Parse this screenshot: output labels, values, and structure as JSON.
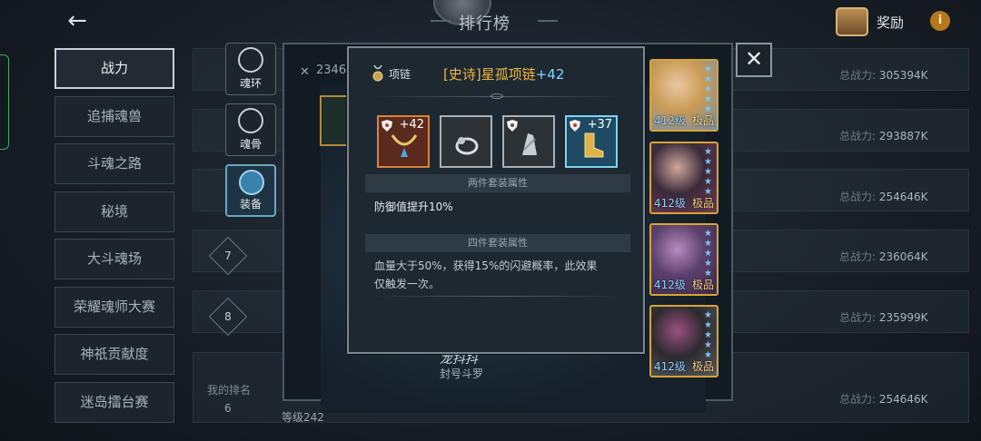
{
  "header": {
    "title": "排行榜",
    "reward_label": "奖励",
    "info_label": "i"
  },
  "categories": [
    {
      "label": "战力",
      "active": true
    },
    {
      "label": "追捕魂兽"
    },
    {
      "label": "斗魂之路"
    },
    {
      "label": "秘境"
    },
    {
      "label": "大斗魂场"
    },
    {
      "label": "荣耀魂师大赛"
    },
    {
      "label": "神祇贡献度"
    },
    {
      "label": "迷岛擂台赛"
    }
  ],
  "rankings": {
    "power_label": "总战力:",
    "rows": [
      {
        "rank": "",
        "power": "305394K"
      },
      {
        "rank": "",
        "power": "293887K"
      },
      {
        "rank": "",
        "power": "254646K"
      },
      {
        "rank": "7",
        "power": "236064K"
      },
      {
        "rank": "8",
        "power": "235999K"
      }
    ],
    "my_rank_label": "我的排名",
    "my_rank_value": "6",
    "my_power": "254646K"
  },
  "player": {
    "id_prefix": "2346",
    "name": "龙抖抖",
    "title": "封号斗罗",
    "level_text": "等级242"
  },
  "side_tabs": [
    {
      "label": "魂环",
      "icon": "soul-ring-icon"
    },
    {
      "label": "魂骨",
      "icon": "soul-bone-icon"
    },
    {
      "label": "装备",
      "icon": "equipment-icon",
      "active": true
    }
  ],
  "characters": [
    {
      "level": "412级",
      "grade": "极品",
      "stars": 5,
      "colors": [
        "#c99a55",
        "#e8c8a0",
        "#6f8fb0"
      ]
    },
    {
      "level": "412级",
      "grade": "极品",
      "stars": 5,
      "colors": [
        "#3a2a3a",
        "#cfa79a",
        "#6d3b52"
      ]
    },
    {
      "level": "412级",
      "grade": "极品",
      "stars": 5,
      "colors": [
        "#5b3f6d",
        "#b78bbf",
        "#3a2a45"
      ]
    },
    {
      "level": "412级",
      "grade": "极品",
      "stars": 5,
      "colors": [
        "#2b2a2f",
        "#9b4f80",
        "#5a5c62"
      ]
    }
  ],
  "tooltip": {
    "slot_label": "项链",
    "item_name": "[史诗]星孤项链",
    "item_plus": "+42",
    "equips": [
      {
        "icon": "necklace-icon",
        "level": "+42",
        "border": "#e0803a",
        "bg": "#5a2a1e"
      },
      {
        "icon": "ring-icon",
        "level": "",
        "border": "#a9b1b8",
        "bg": "#2d3237"
      },
      {
        "icon": "bracer-icon",
        "level": "",
        "border": "#a9b1b8",
        "bg": "#2d3237"
      },
      {
        "icon": "boots-icon",
        "level": "+37",
        "border": "#7fd4f2",
        "bg": "#1e4a63"
      }
    ],
    "set2_header": "两件套装属性",
    "set2_text": "防御值提升10%",
    "set4_header": "四件套装属性",
    "set4_text": "血量大于50%，获得15%的闪避概率，此效果仅触发一次。"
  },
  "colors": {
    "epic_gold": "#f0b640",
    "plus_blue": "#7fd6ff",
    "frame_gold": "#d6a536"
  }
}
